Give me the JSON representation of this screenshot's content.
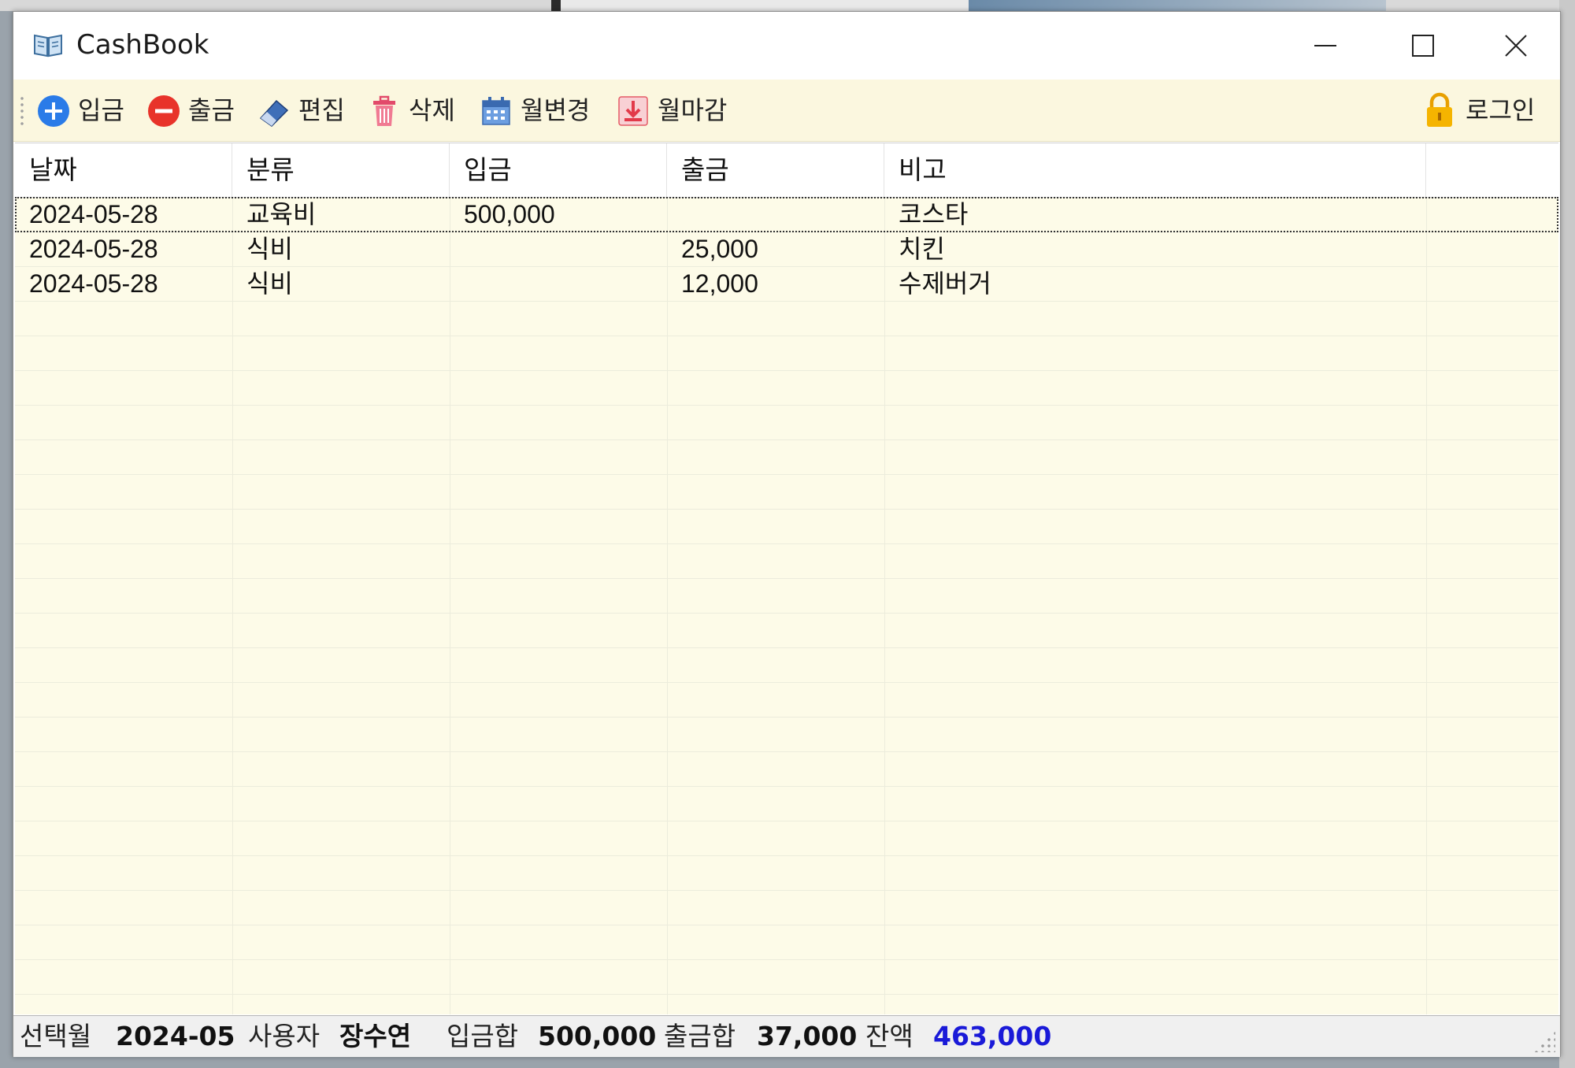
{
  "window": {
    "title": "CashBook"
  },
  "toolbar": {
    "deposit_label": "입금",
    "withdraw_label": "출금",
    "edit_label": "편집",
    "delete_label": "삭제",
    "change_month_label": "월변경",
    "close_month_label": "월마감",
    "login_label": "로그인"
  },
  "grid": {
    "columns": [
      "날짜",
      "분류",
      "입금",
      "출금",
      "비고"
    ],
    "rows": [
      {
        "date": "2024-05-28",
        "category": "교육비",
        "deposit": "500,000",
        "withdraw": "",
        "note": "코스타"
      },
      {
        "date": "2024-05-28",
        "category": "식비",
        "deposit": "",
        "withdraw": "25,000",
        "note": "치킨"
      },
      {
        "date": "2024-05-28",
        "category": "식비",
        "deposit": "",
        "withdraw": "12,000",
        "note": "수제버거"
      }
    ]
  },
  "status": {
    "month_label": "선택월",
    "month_value": "2024-05",
    "user_label": "사용자",
    "user_value": "장수연",
    "deposit_sum_label": "입금합",
    "deposit_sum_value": "500,000",
    "withdraw_sum_label": "출금합",
    "withdraw_sum_value": "37,000",
    "balance_label": "잔액",
    "balance_value": "463,000"
  },
  "colors": {
    "toolbar_bg": "#fbf7df",
    "grid_bg": "#fdfbe8",
    "balance_text": "#1a1ad8",
    "deposit_icon": "#2a7be8",
    "withdraw_icon": "#e8332a"
  },
  "icons": {
    "app": "book-icon",
    "deposit": "plus-circle-icon",
    "withdraw": "minus-circle-icon",
    "edit": "eraser-icon",
    "delete": "trash-icon",
    "change_month": "calendar-icon",
    "close_month": "download-icon",
    "login": "lock-icon"
  }
}
